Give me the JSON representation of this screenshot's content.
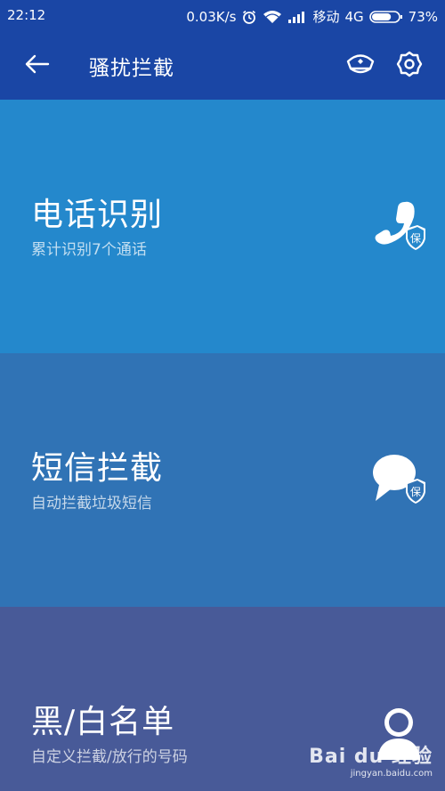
{
  "status_bar": {
    "time": "22:12",
    "speed": "0.03K/s",
    "carrier": "移动",
    "network": "4G",
    "battery": "73%",
    "battery_level": 0.73
  },
  "header": {
    "title": "骚扰拦截",
    "back_icon": "back-arrow-icon",
    "left_icon": "police-cap-icon",
    "right_icon": "settings-icon"
  },
  "cards": [
    {
      "title": "电话识别",
      "subtitle": "累计识别7个通话",
      "icon": "phone-shield-icon",
      "badge": "保"
    },
    {
      "title": "短信拦截",
      "subtitle": "自动拦截垃圾短信",
      "icon": "message-shield-icon",
      "badge": "保"
    },
    {
      "title": "黑/白名单",
      "subtitle": "自定义拦截/放行的号码",
      "icon": "contacts-icon"
    }
  ],
  "watermark": {
    "logo": "Bai du 经验",
    "url": "jingyan.baidu.com"
  },
  "colors": {
    "app_bar": "#1a46a5",
    "card_1": "#2488cc",
    "card_2": "#3073b5",
    "card_3": "#485a98"
  }
}
